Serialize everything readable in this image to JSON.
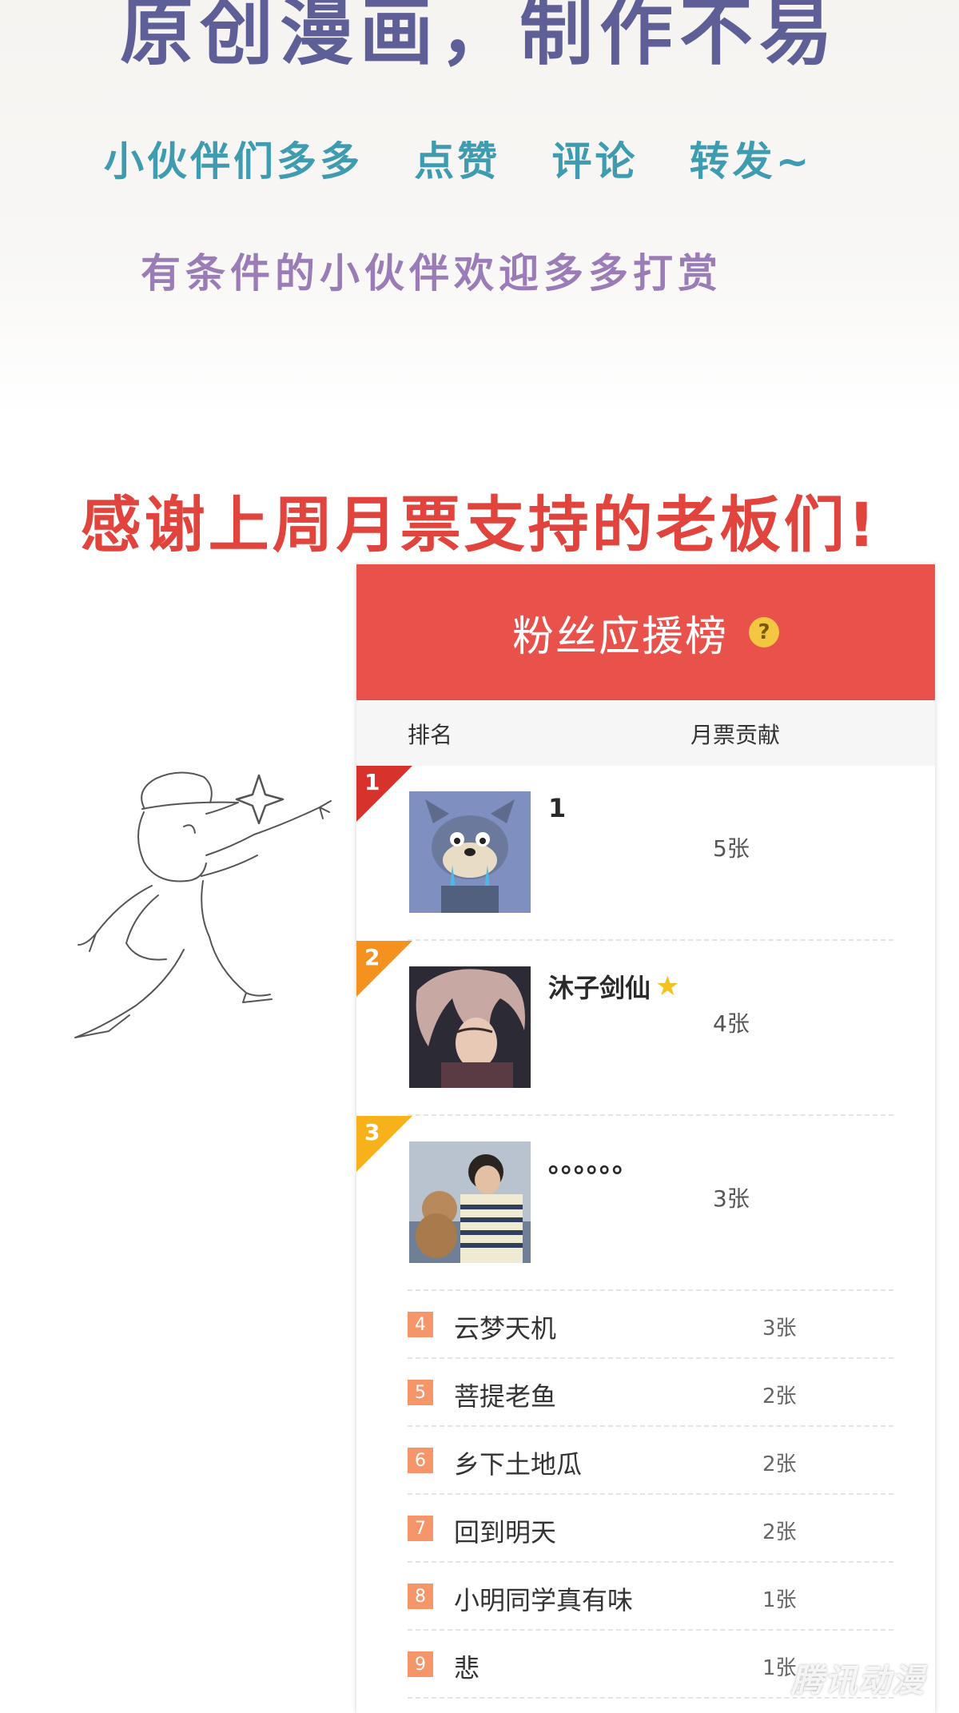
{
  "header": {
    "headline": "原创漫画，制作不易",
    "appeal": "小伙伴们多多   点赞   评论   转发~",
    "donation": "有条件的小伙伴欢迎多多打赏"
  },
  "thanks": "感谢上周月票支持的老板们!",
  "leaderboard": {
    "title": "粉丝应援榜",
    "help_glyph": "?",
    "columns": {
      "rank": "排名",
      "votes": "月票贡献"
    },
    "top": [
      {
        "rank": "1",
        "name": "1",
        "votes": "5张",
        "ribbon_color": "#d7322b"
      },
      {
        "rank": "2",
        "name": "沐子剑仙",
        "votes": "4张",
        "ribbon_color": "#f5911f",
        "badge": "star-icon"
      },
      {
        "rank": "3",
        "name": "。。。。。。",
        "votes": "3张",
        "ribbon_color": "#f7b21b"
      }
    ],
    "rest": [
      {
        "rank": "4",
        "name": "云梦天机",
        "votes": "3张"
      },
      {
        "rank": "5",
        "name": "菩提老鱼",
        "votes": "2张"
      },
      {
        "rank": "6",
        "name": "乡下土地瓜",
        "votes": "2张"
      },
      {
        "rank": "7",
        "name": "回到明天",
        "votes": "2张"
      },
      {
        "rank": "8",
        "name": "小明同学真有味",
        "votes": "1张"
      },
      {
        "rank": "9",
        "name": "悲",
        "votes": "1张"
      }
    ]
  },
  "watermark": "腾讯动漫"
}
